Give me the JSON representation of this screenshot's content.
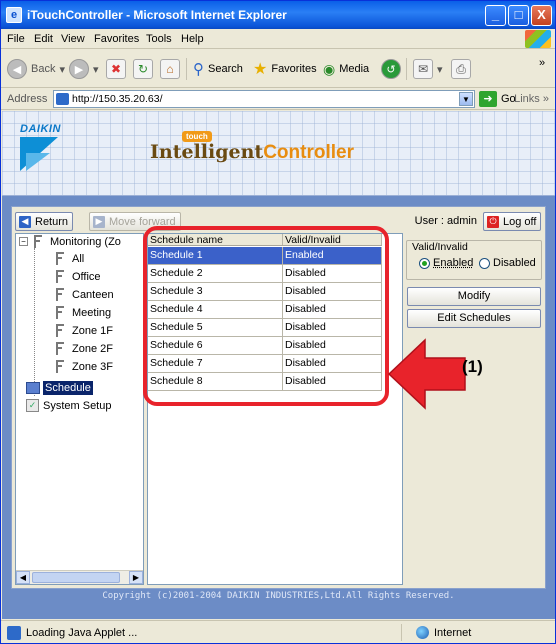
{
  "window": {
    "title": "iTouchController - Microsoft Internet Explorer",
    "controls": [
      "_",
      "□",
      "X"
    ]
  },
  "menu": [
    "File",
    "Edit",
    "View",
    "Favorites",
    "Tools",
    "Help"
  ],
  "toolbar": {
    "back_label": "Back",
    "search_label": "Search",
    "favorites_label": "Favorites",
    "media_label": "Media"
  },
  "address": {
    "label": "Address",
    "value": "http://150.35.20.63/",
    "go_label": "Go",
    "links_label": "Links"
  },
  "banner": {
    "brand": "DAIKIN",
    "logo_intelligent": "Intelligent",
    "logo_controller": "Controller",
    "logo_touch": "touch"
  },
  "app": {
    "return_label": "Return",
    "move_forward_label": "Move forward",
    "user_text": "User : admin",
    "logoff_label": "Log off"
  },
  "tree": {
    "root": "Monitoring (Zo",
    "zones": [
      "All",
      "Office",
      "Canteen",
      "Meeting",
      "Zone 1F",
      "Zone 2F",
      "Zone 3F"
    ],
    "schedule": "Schedule",
    "system_setup": "System Setup"
  },
  "table": {
    "headers": [
      "Schedule name",
      "Valid/Invalid"
    ],
    "rows": [
      [
        "Schedule 1",
        "Enabled"
      ],
      [
        "Schedule 2",
        "Disabled"
      ],
      [
        "Schedule 3",
        "Disabled"
      ],
      [
        "Schedule 4",
        "Disabled"
      ],
      [
        "Schedule 5",
        "Disabled"
      ],
      [
        "Schedule 6",
        "Disabled"
      ],
      [
        "Schedule 7",
        "Disabled"
      ],
      [
        "Schedule 8",
        "Disabled"
      ]
    ],
    "selected_index": 0
  },
  "panel": {
    "group_label": "Valid/Invalid",
    "enabled_label": "Enabled",
    "disabled_label": "Disabled",
    "selected": "Enabled",
    "modify_label": "Modify",
    "edit_label": "Edit Schedules"
  },
  "annotation": {
    "label": "(1)",
    "color": "#e8232b"
  },
  "footer": {
    "copyright": "Copyright (c)2001-2004 DAIKIN INDUSTRIES,Ltd.All Rights Reserved."
  },
  "status": {
    "text": "Loading Java Applet ...",
    "zone": "Internet"
  }
}
